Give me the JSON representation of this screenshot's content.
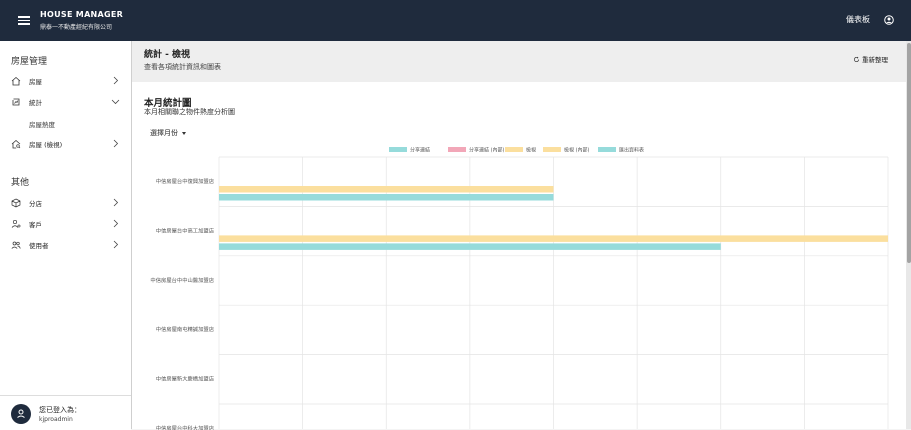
{
  "header": {
    "app_title": "HOUSE MANAGER",
    "company": "鼎泰一不動產經紀有限公司",
    "dashboard_label": "儀表板"
  },
  "sidebar": {
    "section_house": "房屋管理",
    "items": [
      {
        "label": "房屋",
        "icon": "house-icon"
      },
      {
        "label": "統計",
        "icon": "chart-box-icon"
      },
      {
        "label": "房屋 (檢視)",
        "icon": "house-search-icon"
      }
    ],
    "sub_items": [
      {
        "label": "房屋熱度"
      }
    ],
    "section_other": "其他",
    "other_items": [
      {
        "label": "分店",
        "icon": "cube-icon"
      },
      {
        "label": "客戶",
        "icon": "customer-icon"
      },
      {
        "label": "使用者",
        "icon": "users-icon"
      }
    ],
    "login_label": "您已登入為：",
    "login_user": "kjproadmin"
  },
  "page": {
    "title": "統計 - 檢視",
    "subtitle": "查看各項統計資訊和圖表",
    "refresh_label": "重新整理"
  },
  "card": {
    "title": "本月統計圖",
    "subtitle": "本月相關聯之物件熱度分析圖",
    "month_select": "選擇月份"
  },
  "chart_data": {
    "type": "bar",
    "orientation": "horizontal",
    "categories": [
      "中信房屋台中復興加盟店",
      "中信房屋台中高工加盟店",
      "中信房屋台中中山醫加盟店",
      "中信房屋南屯精誠加盟店",
      "中信房屋新大慶橋加盟店",
      "中信房屋台中科大加盟店"
    ],
    "series": [
      {
        "name": "分享連結",
        "color": "#f2a7b8",
        "values": [
          0,
          0,
          0,
          0,
          0,
          0
        ]
      },
      {
        "name": "分享連結 (內部)",
        "color": "#f2a7b8",
        "values": [
          0,
          0,
          0,
          0,
          0,
          0
        ]
      },
      {
        "name": "檢視",
        "color": "#fbdf9e",
        "values": [
          0,
          0,
          0,
          0,
          0,
          0
        ]
      },
      {
        "name": "檢視 (內部)",
        "color": "#fbdf9e",
        "values": [
          4,
          8,
          0,
          0,
          0,
          0
        ]
      },
      {
        "name": "匯出資料表",
        "color": "#96dbdb",
        "values": [
          4,
          6,
          0,
          0,
          0,
          0
        ]
      }
    ],
    "legend": [
      {
        "name": "分享連結",
        "color": "#96dbdb"
      },
      {
        "name": "分享連結 (內部)",
        "color": "#f2a7b8"
      },
      {
        "name": "檢視",
        "color": "#fbdf9e"
      },
      {
        "name": "檢視 (內部)",
        "color": "#fbdf9e"
      },
      {
        "name": "匯出資料表",
        "color": "#96dbdb"
      }
    ],
    "xlim": [
      0,
      8
    ],
    "grid": true,
    "legend_position": "top"
  }
}
